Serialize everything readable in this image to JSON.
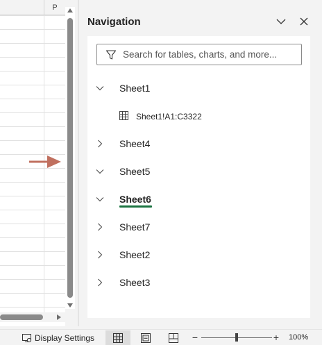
{
  "sheet": {
    "column_header": "P"
  },
  "navigation": {
    "title": "Navigation",
    "search": {
      "placeholder": "Search for tables, charts, and more..."
    },
    "items": [
      {
        "label": "Sheet1",
        "expanded": true,
        "active": false
      },
      {
        "label": "Sheet4",
        "expanded": false,
        "active": false
      },
      {
        "label": "Sheet5",
        "expanded": true,
        "active": false
      },
      {
        "label": "Sheet6",
        "expanded": true,
        "active": true
      },
      {
        "label": "Sheet7",
        "expanded": false,
        "active": false
      },
      {
        "label": "Sheet2",
        "expanded": false,
        "active": false
      },
      {
        "label": "Sheet3",
        "expanded": false,
        "active": false
      }
    ],
    "sheet1_child": {
      "label": "Sheet1!A1:C3322",
      "icon": "table-icon"
    }
  },
  "status_bar": {
    "display_settings_label": "Display Settings",
    "zoom_value": "100%",
    "zoom_minus": "−",
    "zoom_plus": "+",
    "active_view": "normal"
  },
  "colors": {
    "active_underline": "#1a7340",
    "arrow": "#c0705f"
  }
}
